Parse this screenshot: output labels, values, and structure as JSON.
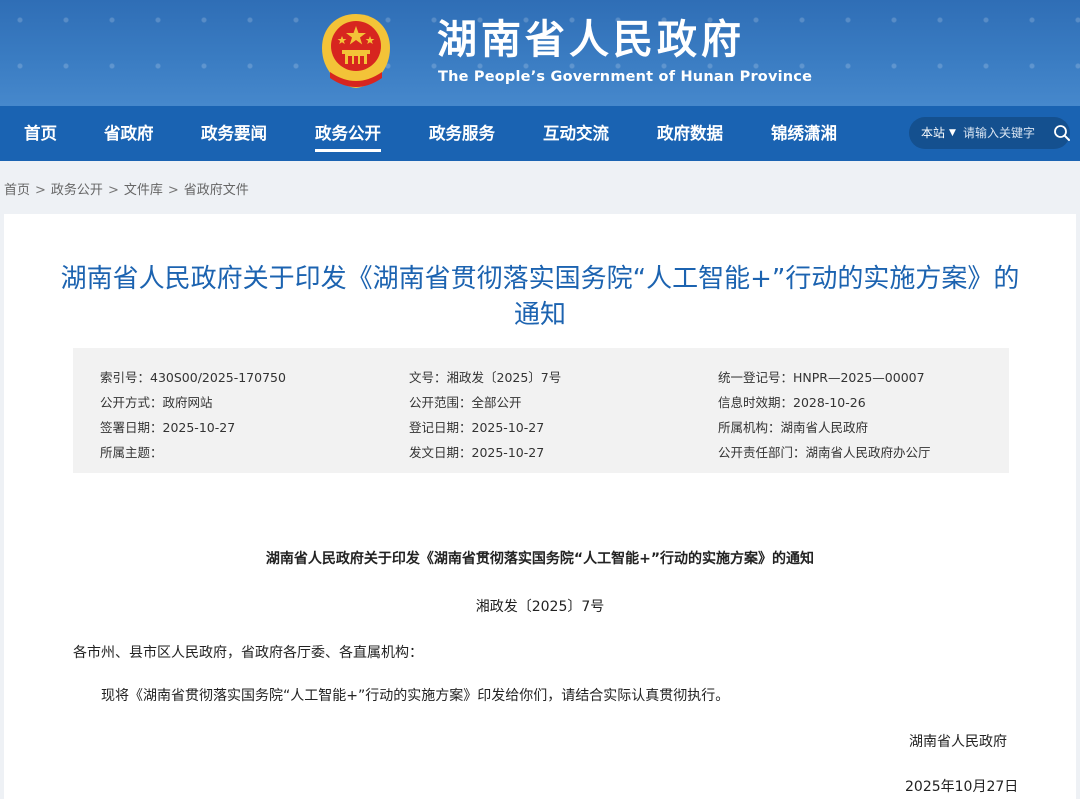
{
  "header": {
    "title": "湖南省人民政府",
    "subtitle": "The People’s Government of Hunan Province",
    "colors": {
      "banner": "#2f6eb6",
      "nav": "#1a63b2",
      "emblem_red": "#d7251f",
      "emblem_gold": "#f3c338"
    }
  },
  "nav": {
    "items": [
      "首页",
      "省政府",
      "政务要闻",
      "政务公开",
      "政务服务",
      "互动交流",
      "政府数据",
      "锦绣潇湘"
    ],
    "active": "政务公开",
    "search": {
      "scope": "本站",
      "placeholder": "请输入关键字"
    }
  },
  "breadcrumb": [
    "首页",
    "政务公开",
    "文件库",
    "省政府文件"
  ],
  "document": {
    "title": "湖南省人民政府关于印发《湖南省贯彻落实国务院“人工智能+”行动的实施方案》的通知",
    "meta": {
      "index_no": "索引号：430S00/2025-170750",
      "doc_no": "文号：湘政发〔2025〕7号",
      "reg_no": "统一登记号：HNPR—2025—00007",
      "open_method": "公开方式：政府网站",
      "open_scope": "公开范围：全部公开",
      "valid_until": "信息时效期：2028-10-26",
      "sign_date": "签署日期：2025-10-27",
      "register_date": "登记日期：2025-10-27",
      "org": "所属机构：湖南省人民政府",
      "topic": "所属主题：",
      "issue_date": "发文日期：2025-10-27",
      "dept": "公开责任部门：湖南省人民政府办公厅"
    },
    "body": {
      "heading": "湖南省人民政府关于印发《湖南省贯彻落实国务院“人工智能+”行动的实施方案》的通知",
      "doc_no": "湘政发〔2025〕7号",
      "salutation": "各市州、县市区人民政府，省政府各厅委、各直属机构：",
      "paragraph": "现将《湖南省贯彻落实国务院“人工智能+”行动的实施方案》印发给你们，请结合实际认真贯彻执行。",
      "signer": "湖南省人民政府",
      "date": "2025年10月27日"
    }
  }
}
